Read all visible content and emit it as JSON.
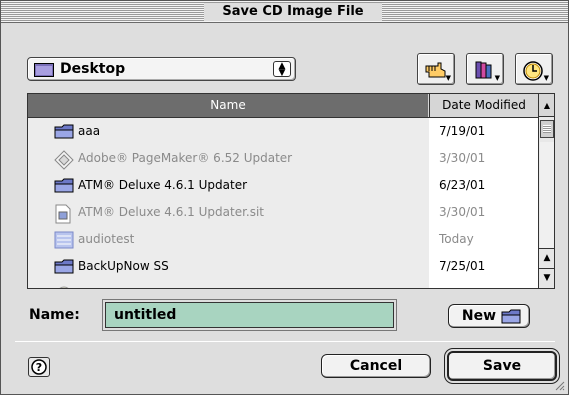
{
  "window": {
    "title": "Save CD Image File"
  },
  "location": {
    "current": "Desktop"
  },
  "list": {
    "columns": {
      "name": "Name",
      "date": "Date Modified"
    },
    "rows": [
      {
        "name": "aaa",
        "date": "7/19/01",
        "icon": "folder-icon",
        "dim": false
      },
      {
        "name": "Adobe® PageMaker® 6.52 Updater",
        "date": "3/30/01",
        "icon": "app-icon",
        "dim": true
      },
      {
        "name": "ATM® Deluxe 4.6.1 Updater",
        "date": "6/23/01",
        "icon": "folder-icon",
        "dim": false
      },
      {
        "name": "ATM® Deluxe 4.6.1 Updater.sit",
        "date": "3/30/01",
        "icon": "archive-icon",
        "dim": true
      },
      {
        "name": "audiotest",
        "date": "Today",
        "icon": "document-icon",
        "dim": true
      },
      {
        "name": "BackUpNow SS",
        "date": "7/25/01",
        "icon": "folder-icon",
        "dim": false
      },
      {
        "name": "",
        "date": "",
        "icon": "document-icon",
        "dim": true
      }
    ]
  },
  "name_field": {
    "label": "Name:",
    "value": "untitled"
  },
  "buttons": {
    "new": "New",
    "cancel": "Cancel",
    "save": "Save"
  }
}
